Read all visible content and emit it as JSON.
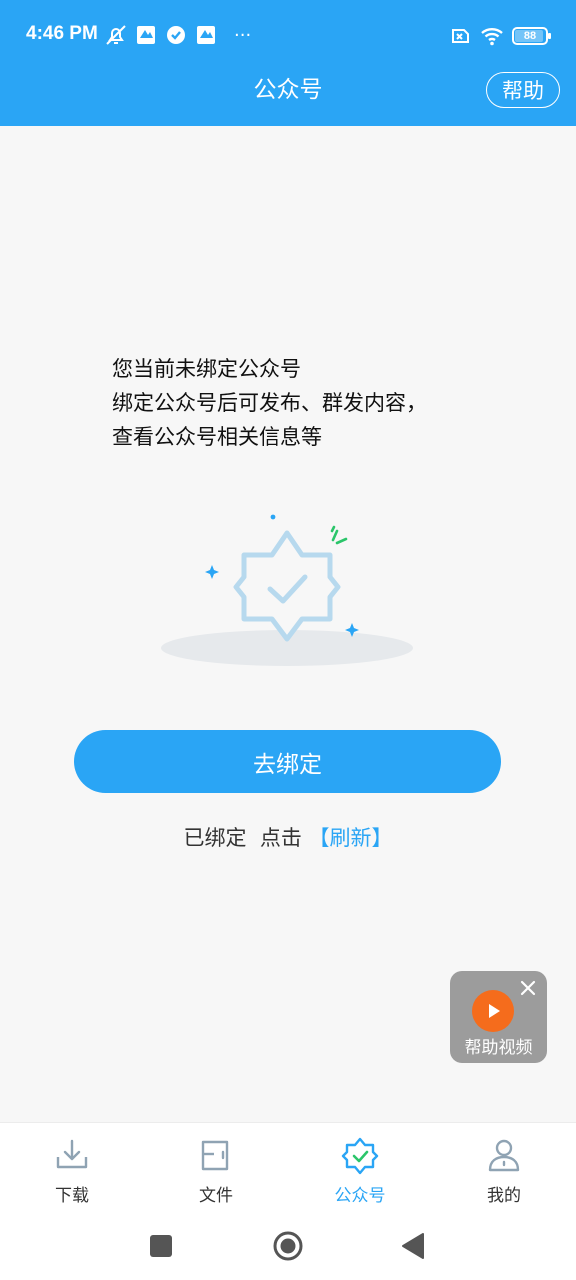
{
  "status_bar": {
    "time": "4:46 PM",
    "more": "···",
    "battery_level": "88",
    "icons": [
      "mute-icon",
      "app-icon",
      "check-circle-icon",
      "app-icon",
      "sim-x-icon",
      "wifi-icon",
      "battery-icon"
    ]
  },
  "header": {
    "title": "公众号",
    "help_label": "帮助"
  },
  "main": {
    "message_lines": [
      "您当前未绑定公众号",
      "绑定公众号后可发布、群发内容，",
      "查看公众号相关信息等"
    ],
    "bind_button": "去绑定",
    "refresh_prefix": "已绑定  点击",
    "refresh_link": "【刷新】"
  },
  "help_video": {
    "label": "帮助视频"
  },
  "tabbar": {
    "tabs": [
      {
        "label": "下载",
        "icon": "download-icon",
        "active": false
      },
      {
        "label": "文件",
        "icon": "folder-icon",
        "active": false
      },
      {
        "label": "公众号",
        "icon": "verified-badge-icon",
        "active": true
      },
      {
        "label": "我的",
        "icon": "profile-icon",
        "active": false
      }
    ]
  },
  "colors": {
    "primary": "#2aa5f5",
    "header_bg": "#2aa5f5",
    "accent_orange": "#f56c1c",
    "page_bg": "#f7f7f7"
  }
}
